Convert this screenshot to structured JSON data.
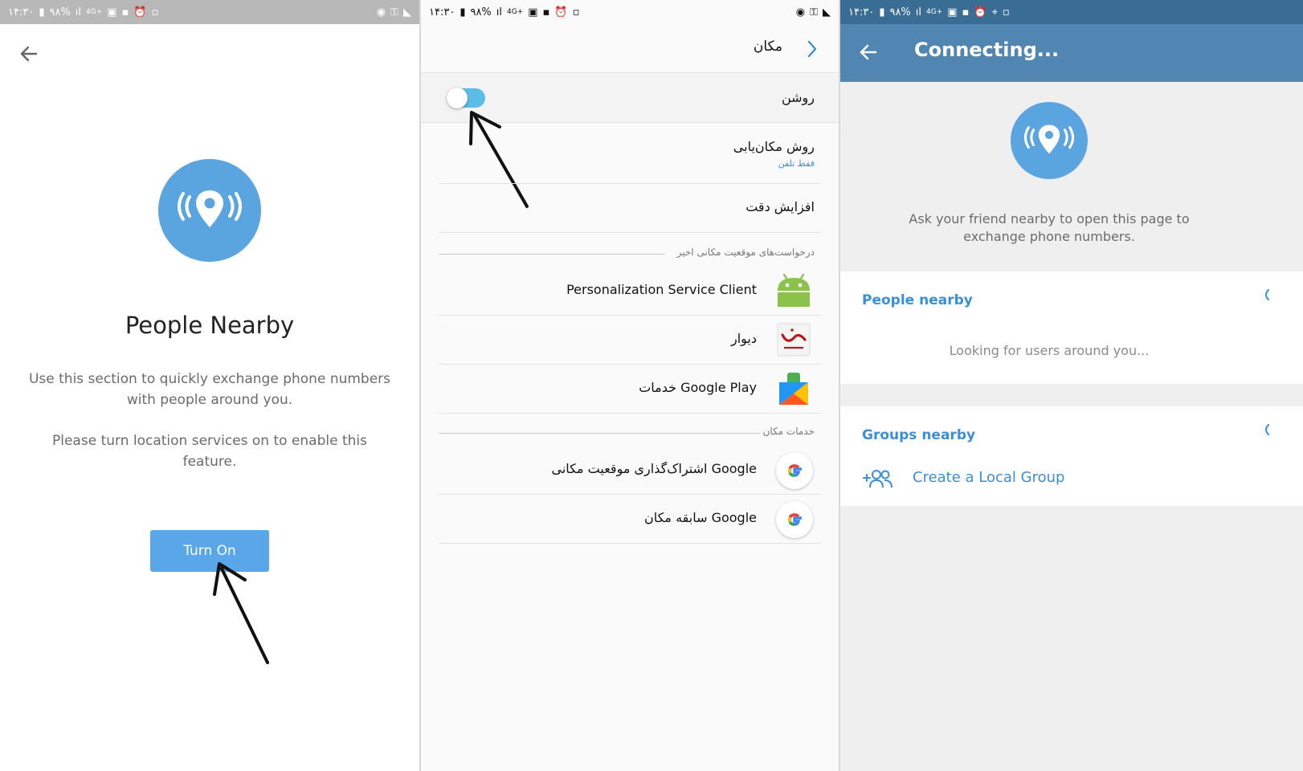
{
  "status_bar": {
    "time": "۱۴:۳۰",
    "battery": "۹۸%",
    "network": "4G+"
  },
  "panel1": {
    "back_icon": "arrow-left-icon",
    "title": "People Nearby",
    "description": "Use this section to quickly exchange phone numbers with people around you.",
    "location_prompt": "Please turn location services on to enable this feature.",
    "button_label": "Turn On",
    "accent_color": "#5aa4df"
  },
  "panel2": {
    "header_title": "مکان",
    "toggle_label": "روشن",
    "toggle_state": "on",
    "method_label": "روش مکان‌یابی",
    "method_value": "فقط تلفن",
    "accuracy_label": "افزایش دقت",
    "recent_header": "درخواست‌های موقعیت مکانی اخیر",
    "recent_apps": [
      {
        "name": "Personalization Service Client",
        "icon": "android-icon"
      },
      {
        "name": "دیوار",
        "icon": "divar-icon"
      },
      {
        "name": "خدمات Google Play",
        "icon": "google-play-services-icon"
      }
    ],
    "services_header": "خدمات مکان",
    "services": [
      {
        "name": "اشتراک‌گذاری موقعیت مکانی Google",
        "icon": "google-icon"
      },
      {
        "name": "سابقه مکان Google",
        "icon": "google-icon"
      }
    ]
  },
  "panel3": {
    "title": "Connecting...",
    "description": "Ask your friend nearby to open this page to exchange phone numbers.",
    "people_header": "People nearby",
    "looking_text": "Looking for users around you...",
    "groups_header": "Groups nearby",
    "create_group_label": "Create a Local Group",
    "header_color": "#5186b3"
  }
}
